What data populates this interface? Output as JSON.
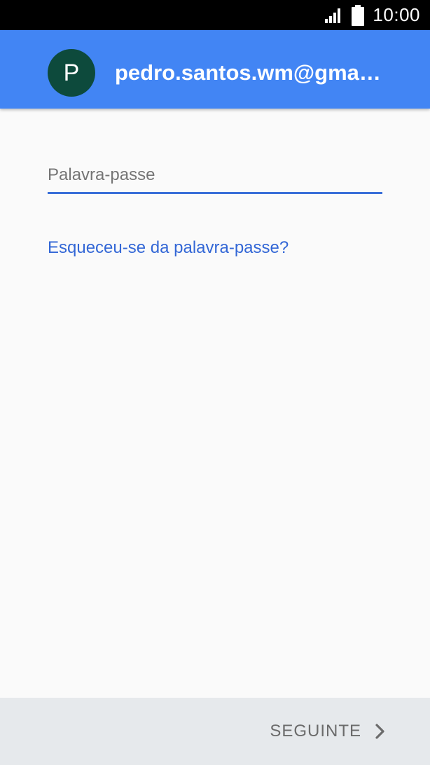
{
  "status_bar": {
    "time": "10:00",
    "signal_icon": "signal-icon",
    "battery_icon": "battery-icon"
  },
  "header": {
    "avatar_letter": "P",
    "email": "pedro.santos.wm@gmail.com",
    "background_color": "#4285f4",
    "avatar_color": "#0d4a3c"
  },
  "form": {
    "password_placeholder": "Palavra-passe",
    "password_value": "",
    "forgot_link": "Esqueceu-se da palavra-passe?",
    "accent_color": "#3a6fd8"
  },
  "footer": {
    "next_label": "SEGUINTE",
    "next_icon": "chevron-right-icon"
  }
}
